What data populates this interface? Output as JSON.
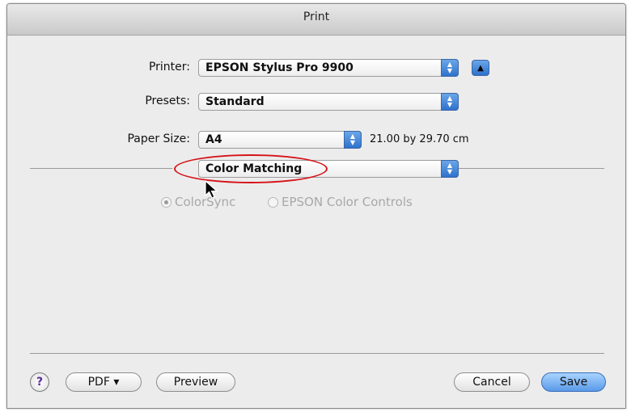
{
  "window": {
    "title": "Print"
  },
  "printer": {
    "label": "Printer:",
    "value": "EPSON Stylus Pro 9900"
  },
  "presets": {
    "label": "Presets:",
    "value": "Standard"
  },
  "paper": {
    "label": "Paper Size:",
    "value": "A4",
    "dimensions": "21.00 by 29.70 cm"
  },
  "panel": {
    "value": "Color Matching"
  },
  "color_options": [
    {
      "label": "ColorSync",
      "selected": true
    },
    {
      "label": "EPSON Color Controls",
      "selected": false
    }
  ],
  "footer": {
    "help": "?",
    "pdf": "PDF ▾",
    "preview": "Preview",
    "cancel": "Cancel",
    "save": "Save"
  },
  "colors": {
    "accent": "#3d82db",
    "annotation": "#d6141a"
  }
}
